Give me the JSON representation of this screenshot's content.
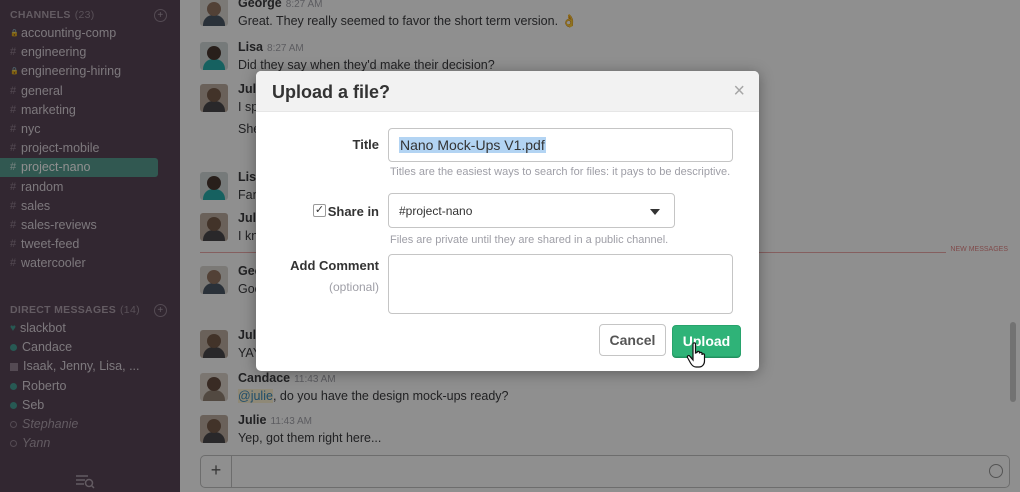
{
  "sidebar": {
    "channels_header": "CHANNELS",
    "channels_count": "(23)",
    "channels": [
      {
        "prefix": "lock",
        "name": "accounting-comp"
      },
      {
        "prefix": "#",
        "name": "engineering"
      },
      {
        "prefix": "lock",
        "name": "engineering-hiring"
      },
      {
        "prefix": "#",
        "name": "general"
      },
      {
        "prefix": "#",
        "name": "marketing"
      },
      {
        "prefix": "#",
        "name": "nyc"
      },
      {
        "prefix": "#",
        "name": "project-mobile"
      },
      {
        "prefix": "#",
        "name": "project-nano",
        "active": true
      },
      {
        "prefix": "#",
        "name": "random"
      },
      {
        "prefix": "#",
        "name": "sales"
      },
      {
        "prefix": "#",
        "name": "sales-reviews"
      },
      {
        "prefix": "#",
        "name": "tweet-feed"
      },
      {
        "prefix": "#",
        "name": "watercooler"
      }
    ],
    "dm_header": "DIRECT MESSAGES",
    "dm_count": "(14)",
    "direct_messages": [
      {
        "status": "heart",
        "name": "slackbot"
      },
      {
        "status": "online",
        "name": "Candace"
      },
      {
        "status": "group",
        "name": "Isaak, Jenny, Lisa, ..."
      },
      {
        "status": "online",
        "name": "Roberto"
      },
      {
        "status": "online",
        "name": "Seb"
      },
      {
        "status": "away",
        "name": "Stephanie"
      },
      {
        "status": "away",
        "name": "Yann"
      }
    ]
  },
  "messages": {
    "george_1": {
      "name": "George",
      "time": "8:27 AM",
      "text": "Great. They really seemed to favor the short term version. 👌"
    },
    "lisa_1": {
      "name": "Lisa",
      "time": "8:27 AM",
      "text": "Did they say when they'd make their decision?"
    },
    "julie_1": {
      "name": "Juli",
      "line1": "I sp",
      "line2": "She"
    },
    "lisa_2": {
      "name": "Lisa",
      "line1": "Fan"
    },
    "julie_2": {
      "name": "Juli",
      "line1": "I kn"
    },
    "george_2": {
      "name": "Geo",
      "line1": "Goo"
    },
    "julie_3": {
      "name": "Juli",
      "line1": "YAY"
    },
    "candace": {
      "name": "Candace",
      "time": "11:43 AM",
      "mention": "@julie",
      "text": ", do you have the design mock-ups ready?"
    },
    "julie_4": {
      "name": "Julie",
      "time": "11:43 AM",
      "text": "Yep, got them right here..."
    },
    "new_messages_label": "NEW MESSAGES"
  },
  "composer": {
    "add_label": "+"
  },
  "modal": {
    "title": "Upload a file?",
    "close": "×",
    "title_label": "Title",
    "title_value": "Nano Mock-Ups V1.pdf",
    "title_hint": "Titles are the easiest ways to search for files: it pays to be descriptive.",
    "share_label": "Share in",
    "share_checked": true,
    "share_value": "#project-nano",
    "share_hint": "Files are private until they are shared in a public channel.",
    "comment_label": "Add Comment",
    "comment_sublabel": "(optional)",
    "comment_value": "",
    "cancel_label": "Cancel",
    "upload_label": "Upload"
  },
  "colors": {
    "sidebar_bg": "#4d394b",
    "active_channel": "#4c9689",
    "upload_button": "#2fb378",
    "new_messages_line": "#e37d7d"
  }
}
